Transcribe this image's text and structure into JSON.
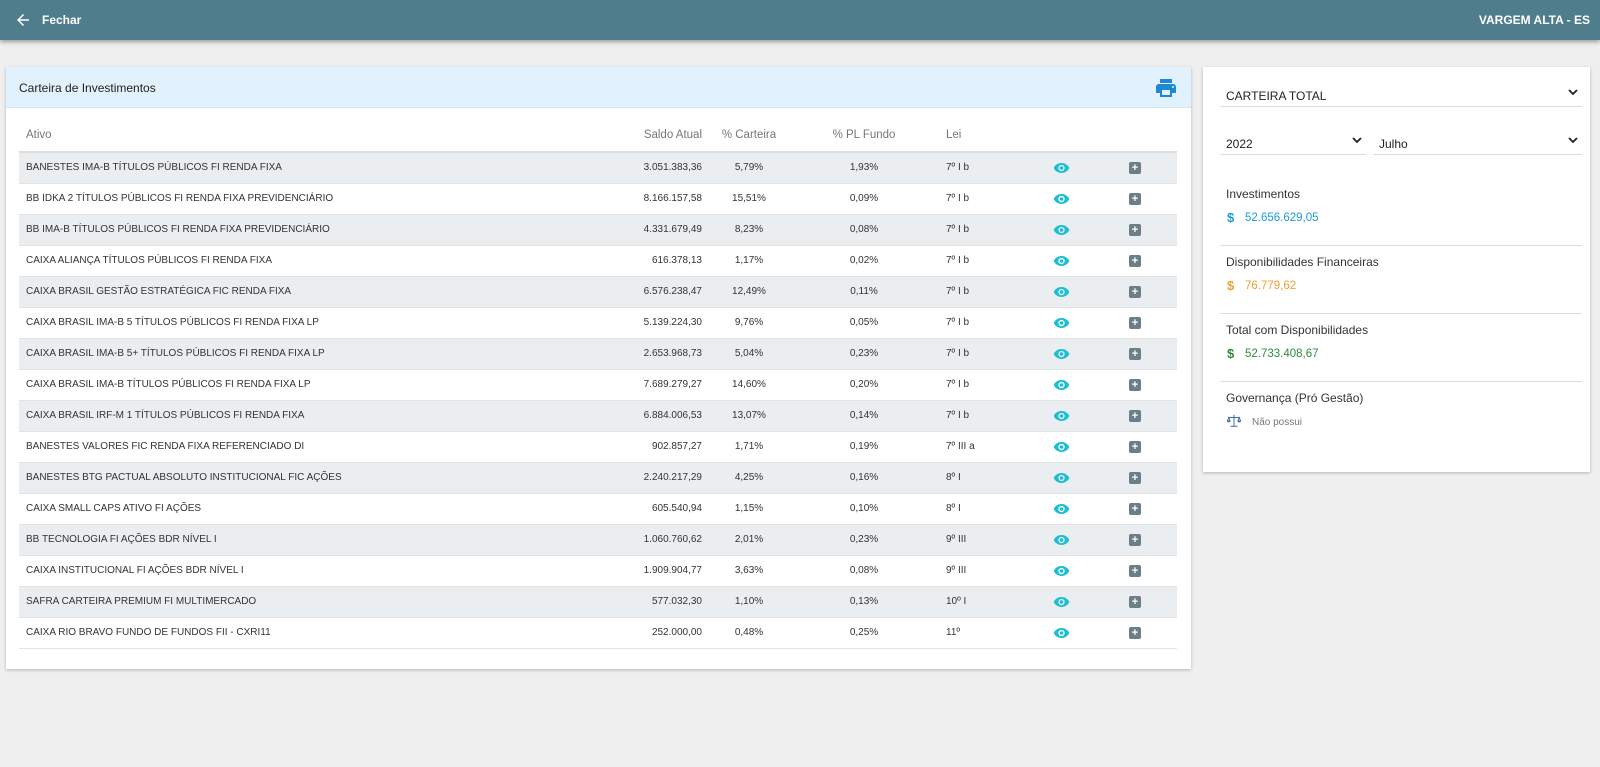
{
  "header": {
    "back_label": "Fechar",
    "municipio": "VARGEM ALTA - ES",
    "bg_color": "#4f7d8c"
  },
  "portfolio": {
    "title": "Carteira de Investimentos",
    "print_icon": "printer-icon",
    "columns": [
      "Ativo",
      "Saldo Atual",
      "% Carteira",
      "% PL Fundo",
      "Lei"
    ],
    "rows": [
      [
        "BANESTES IMA-B TÍTULOS PÚBLICOS FI RENDA FIXA",
        "3.051.383,36",
        "5,79%",
        "1,93%",
        "7º I b"
      ],
      [
        "BB IDKA 2 TÍTULOS PÚBLICOS FI RENDA FIXA PREVIDENCIÁRIO",
        "8.166.157,58",
        "15,51%",
        "0,09%",
        "7º I b"
      ],
      [
        "BB IMA-B TÍTULOS PÚBLICOS FI RENDA FIXA PREVIDENCIÁRIO",
        "4.331.679,49",
        "8,23%",
        "0,08%",
        "7º I b"
      ],
      [
        "CAIXA ALIANÇA TÍTULOS PÚBLICOS FI RENDA FIXA",
        "616.378,13",
        "1,17%",
        "0,02%",
        "7º I b"
      ],
      [
        "CAIXA BRASIL GESTÃO ESTRATÉGICA FIC RENDA FIXA",
        "6.576.238,47",
        "12,49%",
        "0,11%",
        "7º I b"
      ],
      [
        "CAIXA BRASIL IMA-B 5 TÍTULOS PÚBLICOS FI RENDA FIXA LP",
        "5.139.224,30",
        "9,76%",
        "0,05%",
        "7º I b"
      ],
      [
        "CAIXA BRASIL IMA-B 5+ TÍTULOS PÚBLICOS FI RENDA FIXA LP",
        "2.653.968,73",
        "5,04%",
        "0,23%",
        "7º I b"
      ],
      [
        "CAIXA BRASIL IMA-B TÍTULOS PÚBLICOS FI RENDA FIXA LP",
        "7.689.279,27",
        "14,60%",
        "0,20%",
        "7º I b"
      ],
      [
        "CAIXA BRASIL IRF-M 1 TÍTULOS PÚBLICOS FI RENDA FIXA",
        "6.884.006,53",
        "13,07%",
        "0,14%",
        "7º I b"
      ],
      [
        "BANESTES VALORES FIC RENDA FIXA REFERENCIADO DI",
        "902.857,27",
        "1,71%",
        "0,19%",
        "7º III a"
      ],
      [
        "BANESTES BTG PACTUAL ABSOLUTO INSTITUCIONAL FIC AÇÕES",
        "2.240.217,29",
        "4,25%",
        "0,16%",
        "8º I"
      ],
      [
        "CAIXA SMALL CAPS ATIVO FI AÇÕES",
        "605.540,94",
        "1,15%",
        "0,10%",
        "8º I"
      ],
      [
        "BB TECNOLOGIA FI AÇÕES BDR NÍVEL I",
        "1.060.760,62",
        "2,01%",
        "0,23%",
        "9º III"
      ],
      [
        "CAIXA INSTITUCIONAL FI AÇÕES BDR NÍVEL I",
        "1.909.904,77",
        "3,63%",
        "0,08%",
        "9º III"
      ],
      [
        "SAFRA CARTEIRA PREMIUM FI MULTIMERCADO",
        "577.032,30",
        "1,10%",
        "0,13%",
        "10º I"
      ],
      [
        "CAIXA RIO BRAVO FUNDO DE FUNDOS FII - CXRI11",
        "252.000,00",
        "0,48%",
        "0,25%",
        "11º"
      ]
    ],
    "row_icons": [
      "eye-icon",
      "plus-square-icon"
    ],
    "accent_eye": "#1bbfcf"
  },
  "summary": {
    "carteira_select": "CARTEIRA TOTAL",
    "ano_select": "2022",
    "mes_select": "Julho",
    "investimentos": {
      "label": "Investimentos",
      "symbol": "$",
      "value": "52.656.629,05",
      "color": "#1e9bd7"
    },
    "disponibilidades": {
      "label": "Disponibilidades Financeiras",
      "symbol": "$",
      "value": "76.779,62",
      "color": "#f0a030"
    },
    "total": {
      "label": "Total com Disponibilidades",
      "symbol": "$",
      "value": "52.733.408,67",
      "color": "#2e8b3e"
    },
    "governanca": {
      "label": "Governança (Pró Gestão)",
      "icon": "scale-icon",
      "value": "Não possui"
    }
  }
}
